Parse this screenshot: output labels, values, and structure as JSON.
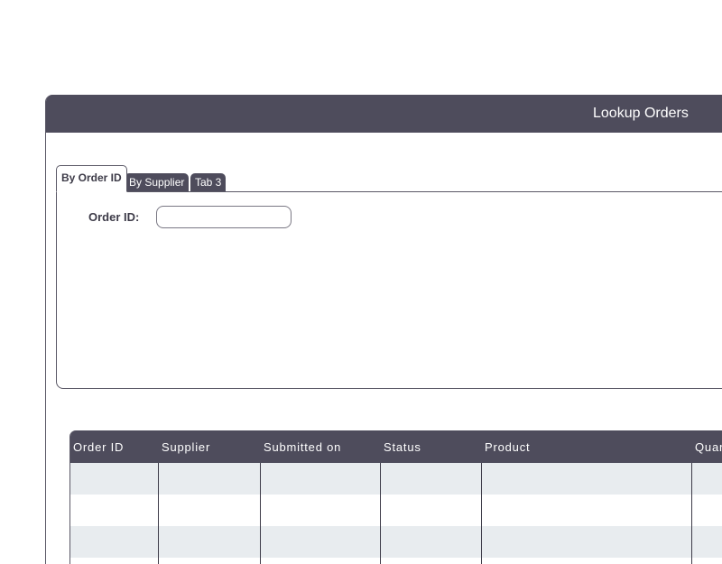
{
  "window": {
    "title": "Lookup Orders"
  },
  "tabs": [
    {
      "label": "By Order ID",
      "active": true
    },
    {
      "label": "By Supplier",
      "active": false
    },
    {
      "label": "Tab 3",
      "active": false
    }
  ],
  "form": {
    "order_id_label": "Order ID:",
    "order_id_value": ""
  },
  "grid": {
    "columns": [
      "Order ID",
      "Supplier",
      "Submitted on",
      "Status",
      "Product",
      "Quantity"
    ],
    "rows": [
      [
        "",
        "",
        "",
        "",
        "",
        ""
      ],
      [
        "",
        "",
        "",
        "",
        "",
        ""
      ],
      [
        "",
        "",
        "",
        "",
        "",
        ""
      ]
    ]
  },
  "colors": {
    "header_bg": "#4e4c5c",
    "row_alt_bg": "#e8ecef",
    "text_dark": "#3d3b48"
  }
}
